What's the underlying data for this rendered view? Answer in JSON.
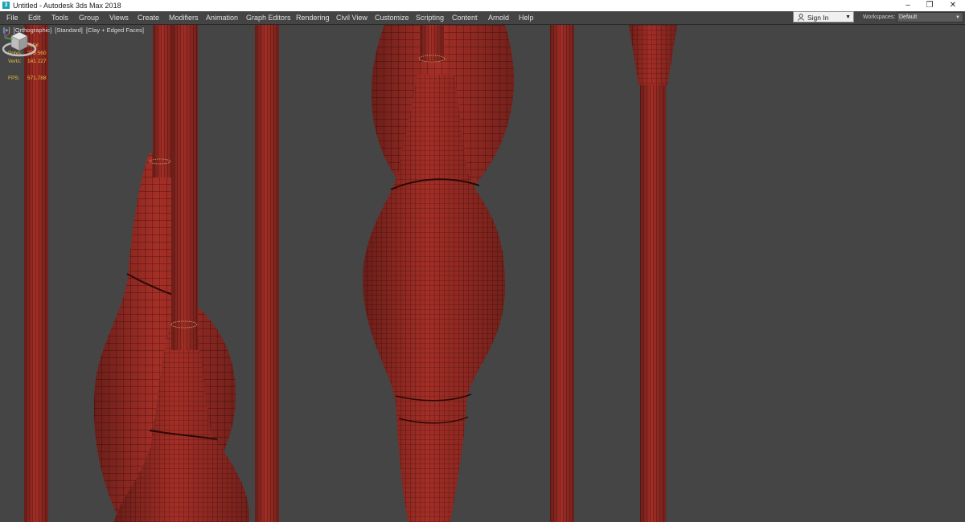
{
  "window": {
    "title": "Untitled - Autodesk 3ds Max 2018",
    "app_icon_glyph": "3",
    "minimize_glyph": "–",
    "maximize_glyph": "❐",
    "close_glyph": "✕"
  },
  "menubar": {
    "items": [
      "File",
      "Edit",
      "Tools",
      "Group",
      "Views",
      "Create",
      "Modifiers",
      "Animation",
      "Graph Editors",
      "Rendering",
      "Civil View",
      "Customize",
      "Scripting",
      "Content",
      "Arnold",
      "Help"
    ]
  },
  "account": {
    "sign_in_label": "Sign In",
    "icon": "user-icon"
  },
  "workspaces": {
    "label": "Workspaces:",
    "value": "Default"
  },
  "viewport": {
    "labels": [
      "[+]",
      "[Orthographic]",
      "[Standard]",
      "[Clay + Edged Faces]"
    ],
    "stats": {
      "total_label": "Total",
      "polys_label": "Polys:",
      "polys_value": "273 560",
      "verts_label": "Verts:",
      "verts_value": "141 227",
      "fps_label": "FPS:",
      "fps_value": "571,788"
    },
    "colors": {
      "background": "#454545",
      "clay": "#a32e26",
      "wire": "#3a0d0a"
    }
  }
}
